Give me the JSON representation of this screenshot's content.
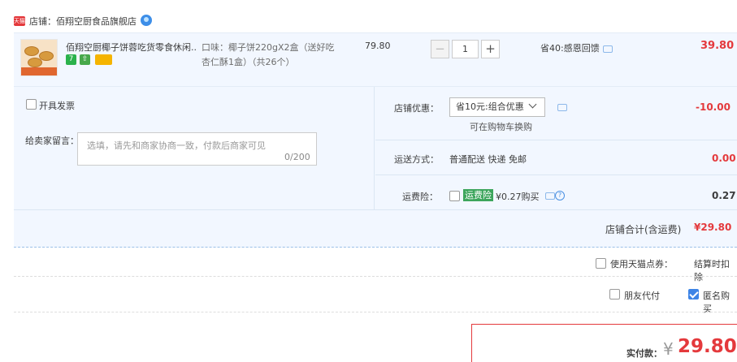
{
  "shop": {
    "logo_text": "天猫",
    "name": "店铺：佰翔空厨食品旗舰店",
    "chat_icon": "wangwang-icon"
  },
  "item": {
    "title": "佰翔空厨椰子饼蓉吃货零食休闲...",
    "badges": [
      "7",
      "⇧",
      ""
    ],
    "sku_line1": "口味：椰子饼220gX2盒（送好吃",
    "sku_line2": "杏仁酥1盒）（共26个）",
    "price": "79.80",
    "qty_minus": "−",
    "qty_value": "1",
    "qty_plus": "+",
    "promo": "省40:感恩回馈",
    "subtotal": "39.80"
  },
  "options": {
    "invoice_label": "开具发票",
    "message_label": "给卖家留言：",
    "message_placeholder": "选填，请先和商家协商一致，付款后商家可见",
    "message_count": "0/200",
    "coupon_label": "店铺优惠：",
    "coupon_selected": "省10元:组合优惠",
    "coupon_note": "可在购物车换购",
    "coupon_amount": "-10.00",
    "shipping_label": "运送方式：",
    "shipping_value": "普通配送 快递 免邮",
    "shipping_amount": "0.00",
    "insurance_label": "运费险：",
    "insurance_tag": "运费险",
    "insurance_value": "¥0.27购买",
    "insurance_amount": "0.27",
    "shop_total_label": "店铺合计(含运费)",
    "shop_total_amount": "¥29.80"
  },
  "extras": {
    "points_label": "使用天猫点券：",
    "points_value": "结算时扣除",
    "friend_pay_label": "朋友代付",
    "anonymous_label": "匿名购买",
    "anonymous_checked": true
  },
  "pay": {
    "label": "实付款：",
    "yen": "¥",
    "amount": "29.80"
  },
  "colors": {
    "accent_red": "#e4393c",
    "panel_bg": "#f2f7ff",
    "checkbox_blue": "#3d84e6"
  }
}
